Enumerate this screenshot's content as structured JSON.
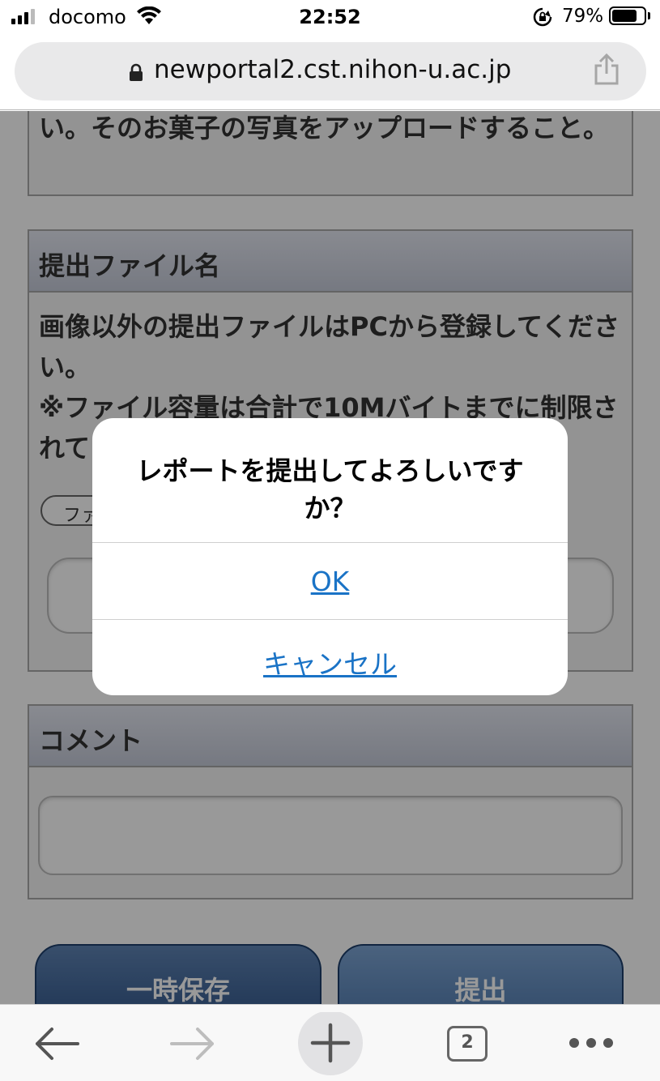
{
  "status_bar": {
    "carrier": "docomo",
    "time": "22:52",
    "battery_percent": "79%",
    "battery_level": 0.79
  },
  "browser": {
    "url": "newportal2.cst.nihon-u.ac.jp",
    "tab_count": "2"
  },
  "page": {
    "description_text": "い。そのお菓子の写真をアップロードすること。",
    "file_section": {
      "header": "提出ファイル名",
      "note_line1": "画像以外の提出ファイルはPCから登録してください。",
      "note_line2": "※ファイル容量は合計で10Mバイトまでに制限されています。",
      "file_button_label": "ファイル"
    },
    "comment_section": {
      "header": "コメント"
    },
    "buttons": {
      "save_draft": "一時保存",
      "submit": "提出"
    }
  },
  "dialog": {
    "message": "レポートを提出してよろしいですか？",
    "ok": "OK",
    "cancel": "キャンセル"
  },
  "colors": {
    "link_blue": "#1a73c6",
    "button_navy": "#3a5f8f",
    "section_header": "#d4d8e4"
  },
  "icons": [
    "signal-icon",
    "wifi-icon",
    "rotation-lock-icon",
    "battery-icon",
    "lock-icon",
    "share-icon",
    "back-arrow-icon",
    "forward-arrow-icon",
    "new-tab-plus-icon",
    "tabs-icon",
    "more-icon"
  ]
}
